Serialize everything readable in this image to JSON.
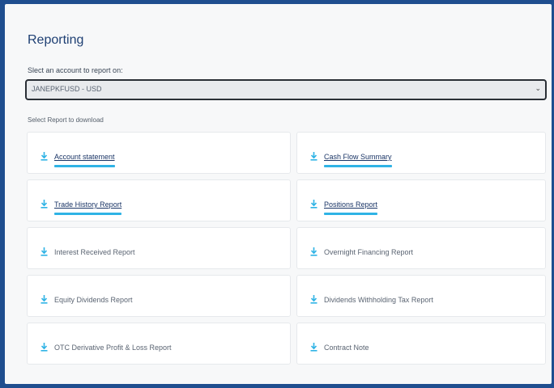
{
  "page": {
    "title": "Reporting",
    "account_label": "Slect an account to report on:",
    "account_selected": "JANEPKFUSD - USD",
    "reports_label": "Select Report to download"
  },
  "colors": {
    "accent": "#2fb3e5",
    "link": "#1a3566",
    "frame": "#1f4e8f"
  },
  "reports": [
    {
      "label": "Account statement",
      "icon": "download-icon",
      "highlighted": true
    },
    {
      "label": "Cash Flow Summary",
      "icon": "download-icon",
      "highlighted": true
    },
    {
      "label": "Trade History Report",
      "icon": "download-icon",
      "highlighted": true
    },
    {
      "label": "Positions Report",
      "icon": "download-icon",
      "highlighted": true
    },
    {
      "label": "Interest Received Report",
      "icon": "download-icon",
      "highlighted": false
    },
    {
      "label": "Overnight Financing Report",
      "icon": "download-icon",
      "highlighted": false
    },
    {
      "label": "Equity Dividends Report",
      "icon": "download-icon",
      "highlighted": false
    },
    {
      "label": "Dividends Withholding Tax Report",
      "icon": "download-icon",
      "highlighted": false
    },
    {
      "label": "OTC Derivative Profit & Loss Report",
      "icon": "download-icon",
      "highlighted": false
    },
    {
      "label": "Contract Note",
      "icon": "download-icon",
      "highlighted": false
    }
  ]
}
